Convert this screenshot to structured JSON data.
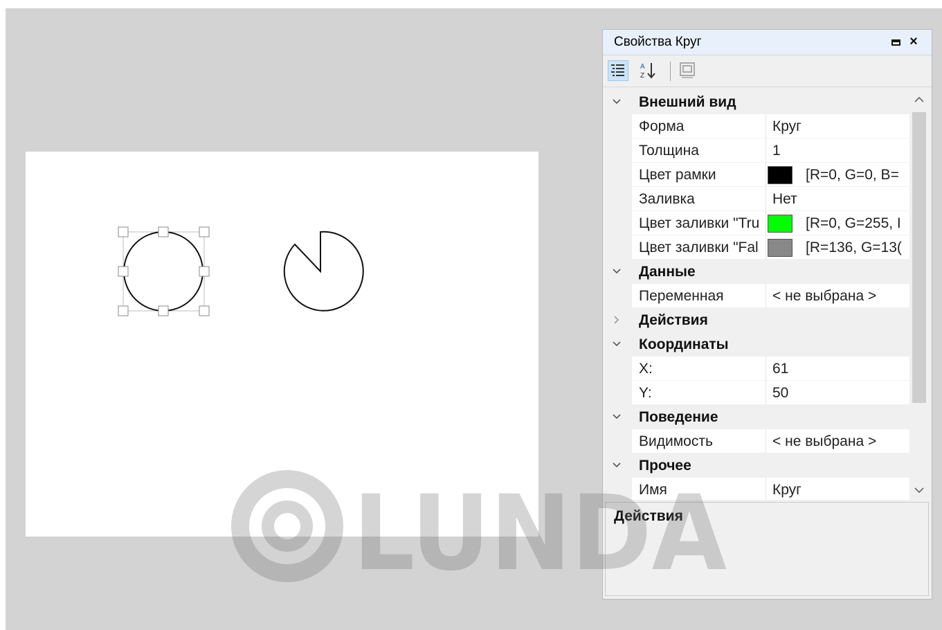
{
  "panel": {
    "title": "Свойства Круг",
    "toolbar": {
      "icons": [
        "categorized-icon",
        "alphabetical-sort-icon",
        "property-pages-icon"
      ]
    }
  },
  "grid": {
    "categories": [
      {
        "label": "Внешний вид",
        "expanded": true,
        "properties": [
          {
            "name": "Форма",
            "value": "Круг"
          },
          {
            "name": "Толщина",
            "value": "1"
          },
          {
            "name": "Цвет рамки",
            "swatch": "#000000",
            "value": "[R=0, G=0, B="
          },
          {
            "name": "Заливка",
            "value": "Нет"
          },
          {
            "name": "Цвет заливки \"Tru",
            "swatch": "#00ff00",
            "value": "[R=0, G=255, I"
          },
          {
            "name": "Цвет заливки \"Fal",
            "swatch": "#888888",
            "value": "[R=136, G=13("
          }
        ]
      },
      {
        "label": "Данные",
        "expanded": true,
        "properties": [
          {
            "name": "Переменная",
            "value": "< не выбрана >"
          }
        ]
      },
      {
        "label": "Действия",
        "expanded": false,
        "properties": []
      },
      {
        "label": "Координаты",
        "expanded": true,
        "properties": [
          {
            "name": "X:",
            "value": "61"
          },
          {
            "name": "Y:",
            "value": "50"
          }
        ]
      },
      {
        "label": "Поведение",
        "expanded": true,
        "properties": [
          {
            "name": "Видимость",
            "value": "< не выбрана >"
          }
        ]
      },
      {
        "label": "Прочее",
        "expanded": true,
        "properties": [
          {
            "name": "Имя",
            "value": "Круг"
          }
        ]
      }
    ]
  },
  "description": {
    "title": "Действия"
  },
  "watermark": {
    "text": "LUNDA"
  },
  "colors": {
    "workspace": "#d3d3d3",
    "selection": "#cce4f7"
  }
}
